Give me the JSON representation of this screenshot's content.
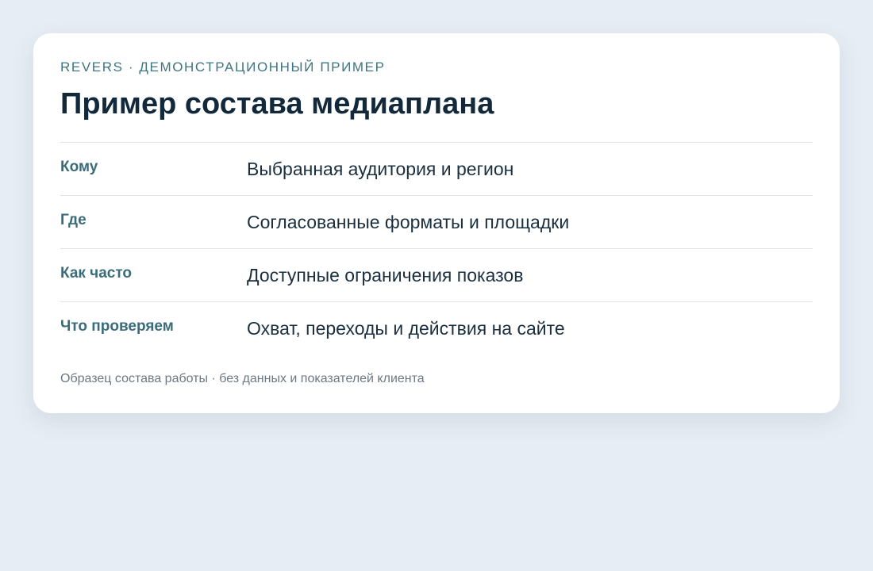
{
  "card": {
    "eyebrow": "REVERS · ДЕМОНСТРАЦИОННЫЙ ПРИМЕР",
    "title": "Пример состава медиаплана",
    "rows": [
      {
        "label": "Кому",
        "value": "Выбранная аудитория и регион"
      },
      {
        "label": "Где",
        "value": "Согласованные форматы и площадки"
      },
      {
        "label": "Как часто",
        "value": "Доступные ограничения показов"
      },
      {
        "label": "Что проверяем",
        "value": "Охват, переходы и действия на сайте"
      }
    ],
    "footer": "Образец состава работы · без данных и показателей клиента"
  },
  "colors": {
    "background": "#e7edf4",
    "card": "#ffffff",
    "accent": "#3f7581",
    "title": "#12293b",
    "muted": "#6b7883"
  }
}
